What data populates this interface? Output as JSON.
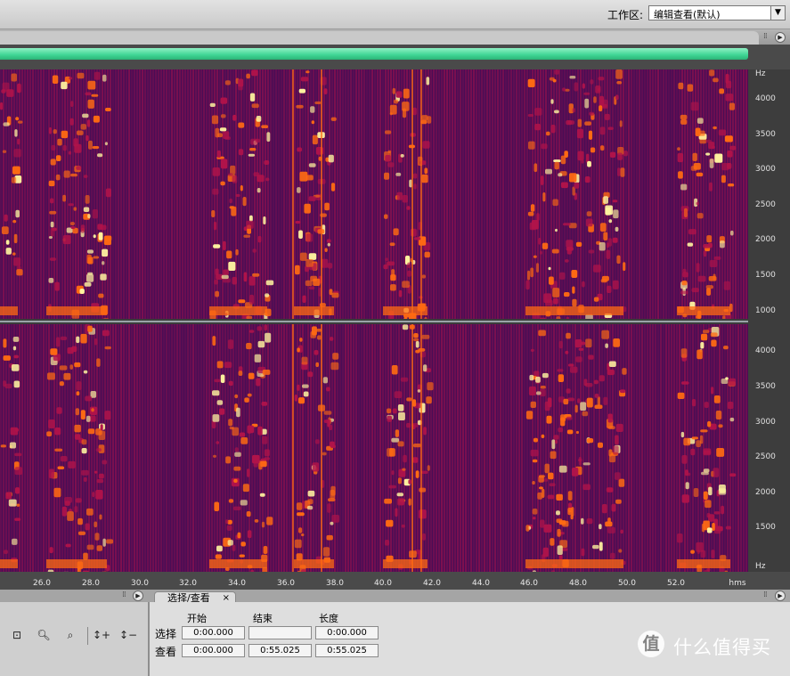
{
  "workspace": {
    "label": "工作区:",
    "selected": "编辑查看(默认)"
  },
  "spectrogram": {
    "freq_axis": {
      "unit": "Hz",
      "top_channel_ticks": [
        "4000",
        "3500",
        "3000",
        "2500",
        "2000",
        "1500",
        "1000"
      ],
      "bottom_channel_ticks": [
        "4000",
        "3500",
        "3000",
        "2500",
        "2000",
        "1500",
        "Hz"
      ]
    },
    "time_axis": {
      "unit": "hms",
      "ticks": [
        "26.0",
        "28.0",
        "30.0",
        "32.0",
        "34.0",
        "36.0",
        "38.0",
        "40.0",
        "42.0",
        "44.0",
        "46.0",
        "48.0",
        "50.0",
        "52.0"
      ]
    },
    "colors": {
      "background": "#4a0d55",
      "mid": "#b0134a",
      "hot": "#ff6a12",
      "peak": "#fff5a0"
    }
  },
  "zoom_toolbar": {
    "icons": [
      "zoom-full-icon",
      "zoom-in-icon",
      "zoom-out-icon",
      "zoom-in-vertical-icon",
      "zoom-out-vertical-icon"
    ]
  },
  "selection_view": {
    "tab_label": "选择/查看",
    "close_glyph": "×",
    "columns": {
      "start": "开始",
      "end": "结束",
      "length": "长度"
    },
    "rows": {
      "selection": {
        "label": "选择",
        "start": "0:00.000",
        "end": "",
        "length": "0:00.000"
      },
      "view": {
        "label": "查看",
        "start": "0:00.000",
        "end": "0:55.025",
        "length": "0:55.025"
      }
    }
  },
  "watermark": {
    "icon": "值",
    "text": "什么值得买"
  }
}
